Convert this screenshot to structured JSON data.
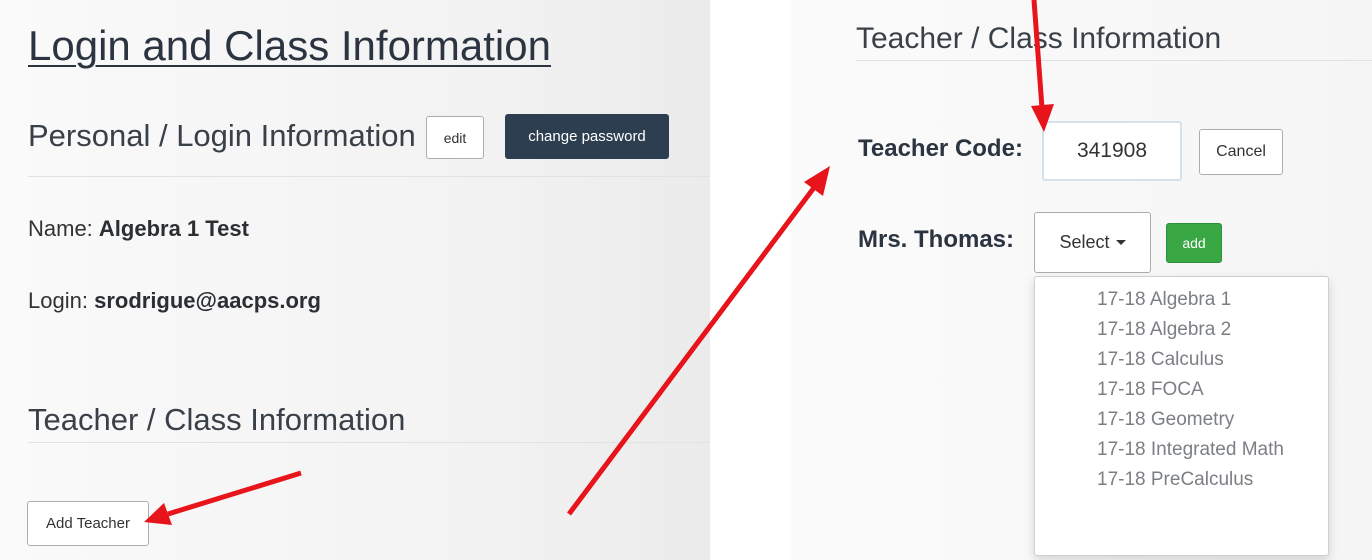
{
  "left": {
    "title": "Login and Class Information",
    "personal_heading": "Personal / Login Information",
    "edit_label": "edit",
    "change_password_label": "change password",
    "name_label": "Name:",
    "name_value": "Algebra 1 Test",
    "login_label": "Login:",
    "login_value": "srodrigue@aacps.org",
    "teacher_heading": "Teacher / Class Information",
    "add_teacher_label": "Add Teacher"
  },
  "right": {
    "teacher_heading": "Teacher / Class Information",
    "teacher_code_label": "Teacher Code:",
    "teacher_code_value": "341908",
    "cancel_label": "Cancel",
    "teacher_name_label": "Mrs. Thomas:",
    "select_label": "Select",
    "add_label": "add",
    "class_options": [
      "17-18 Algebra 1",
      "17-18 Algebra 2",
      "17-18 Calculus",
      "17-18 FOCA",
      "17-18 Geometry",
      "17-18 Integrated Math",
      "17-18 PreCalculus"
    ]
  },
  "colors": {
    "annotation_arrow": "#e8141b",
    "dark_button": "#2c3e50",
    "green_button": "#3aa745"
  }
}
